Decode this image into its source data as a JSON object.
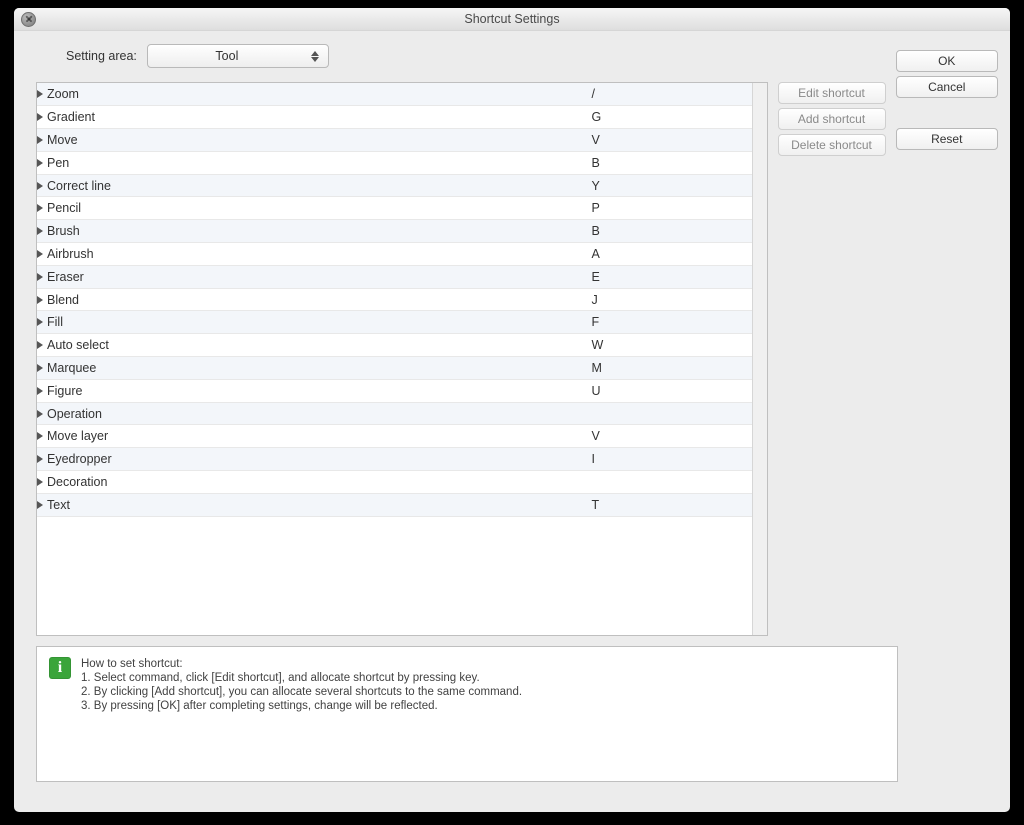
{
  "window": {
    "title": "Shortcut Settings"
  },
  "setting_area": {
    "label": "Setting area:",
    "value": "Tool"
  },
  "shortcuts": [
    {
      "command": "Zoom",
      "key": "/"
    },
    {
      "command": "Gradient",
      "key": "G"
    },
    {
      "command": "Move",
      "key": "V"
    },
    {
      "command": "Pen",
      "key": "B"
    },
    {
      "command": "Correct line",
      "key": "Y"
    },
    {
      "command": "Pencil",
      "key": "P"
    },
    {
      "command": "Brush",
      "key": "B"
    },
    {
      "command": "Airbrush",
      "key": "A"
    },
    {
      "command": "Eraser",
      "key": "E"
    },
    {
      "command": "Blend",
      "key": "J"
    },
    {
      "command": "Fill",
      "key": "F"
    },
    {
      "command": "Auto select",
      "key": "W"
    },
    {
      "command": "Marquee",
      "key": "M"
    },
    {
      "command": "Figure",
      "key": "U"
    },
    {
      "command": "Operation",
      "key": ""
    },
    {
      "command": "Move layer",
      "key": "V"
    },
    {
      "command": "Eyedropper",
      "key": "I"
    },
    {
      "command": "Decoration",
      "key": ""
    },
    {
      "command": "Text",
      "key": "T"
    }
  ],
  "buttons": {
    "edit": "Edit shortcut",
    "add": "Add shortcut",
    "delete": "Delete shortcut",
    "ok": "OK",
    "cancel": "Cancel",
    "reset": "Reset"
  },
  "info": {
    "title": "How to set shortcut:",
    "lines": [
      "1. Select command, click [Edit shortcut], and allocate shortcut by pressing key.",
      "2. By clicking [Add shortcut], you can allocate several shortcuts to the same command.",
      "3. By pressing [OK] after completing settings, change will be reflected."
    ]
  }
}
